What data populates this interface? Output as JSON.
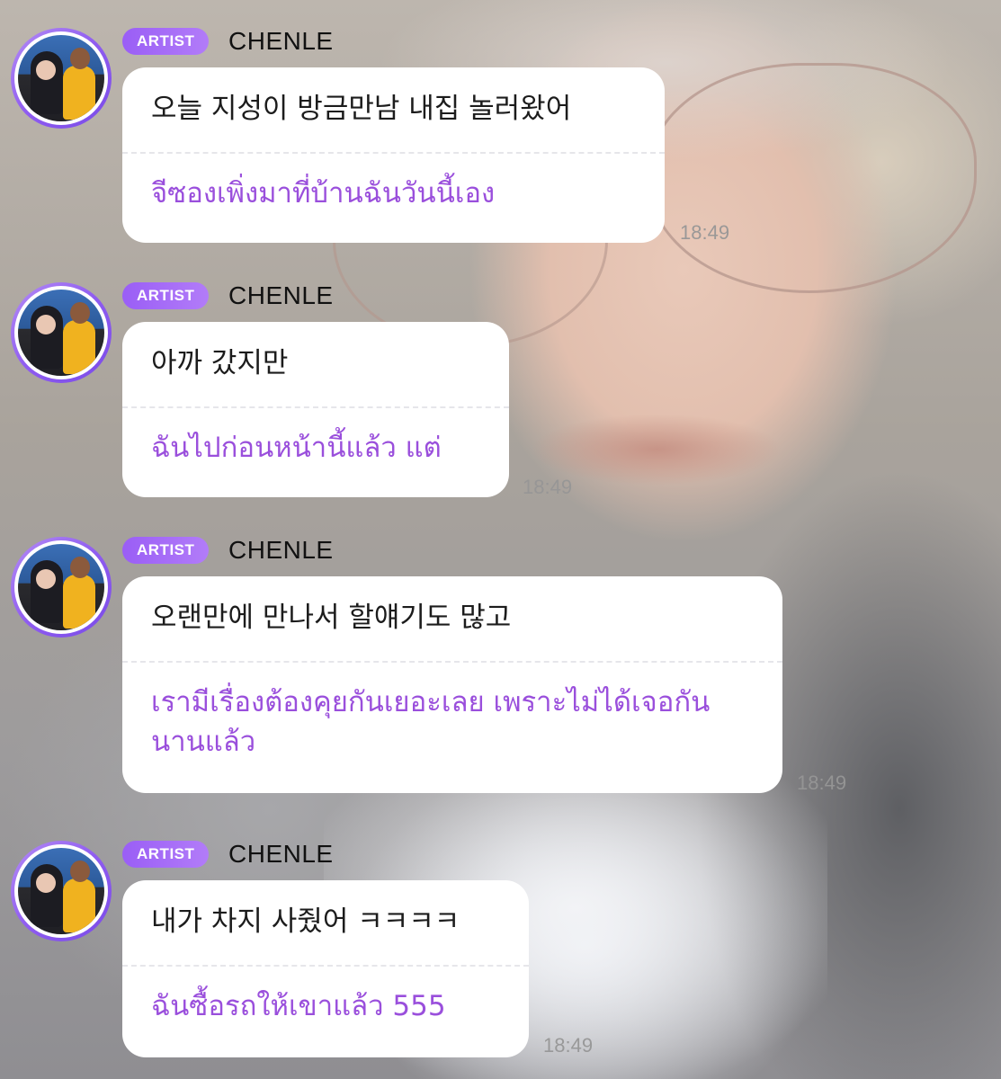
{
  "messages": [
    {
      "badge": "ARTIST",
      "sender": "CHENLE",
      "korean": "오늘 지성이 방금만남 내집 놀러왔어",
      "thai": "จีซองเพิ่งมาที่บ้านฉันวันนี้เอง",
      "time": "18:49"
    },
    {
      "badge": "ARTIST",
      "sender": "CHENLE",
      "korean": "아까 갔지만",
      "thai": "ฉันไปก่อนหน้านี้แล้ว แต่",
      "time": "18:49"
    },
    {
      "badge": "ARTIST",
      "sender": "CHENLE",
      "korean": "오랜만에 만나서 할얘기도 많고",
      "thai": "เรามีเรื่องต้องคุยกันเยอะเลย เพราะไม่ได้เจอกันนานแล้ว",
      "time": "18:49"
    },
    {
      "badge": "ARTIST",
      "sender": "CHENLE",
      "korean": "내가 차지 사줬어 ㅋㅋㅋㅋ",
      "thai": "ฉันซื้อรถให้เขาแล้ว 555",
      "time": "18:49"
    }
  ],
  "colors": {
    "badge": "#9a5ef6",
    "translation_text": "#9a4fdc",
    "avatar_ring": "#8f5cf0"
  },
  "icons": {
    "avatar": "profile-photo"
  }
}
